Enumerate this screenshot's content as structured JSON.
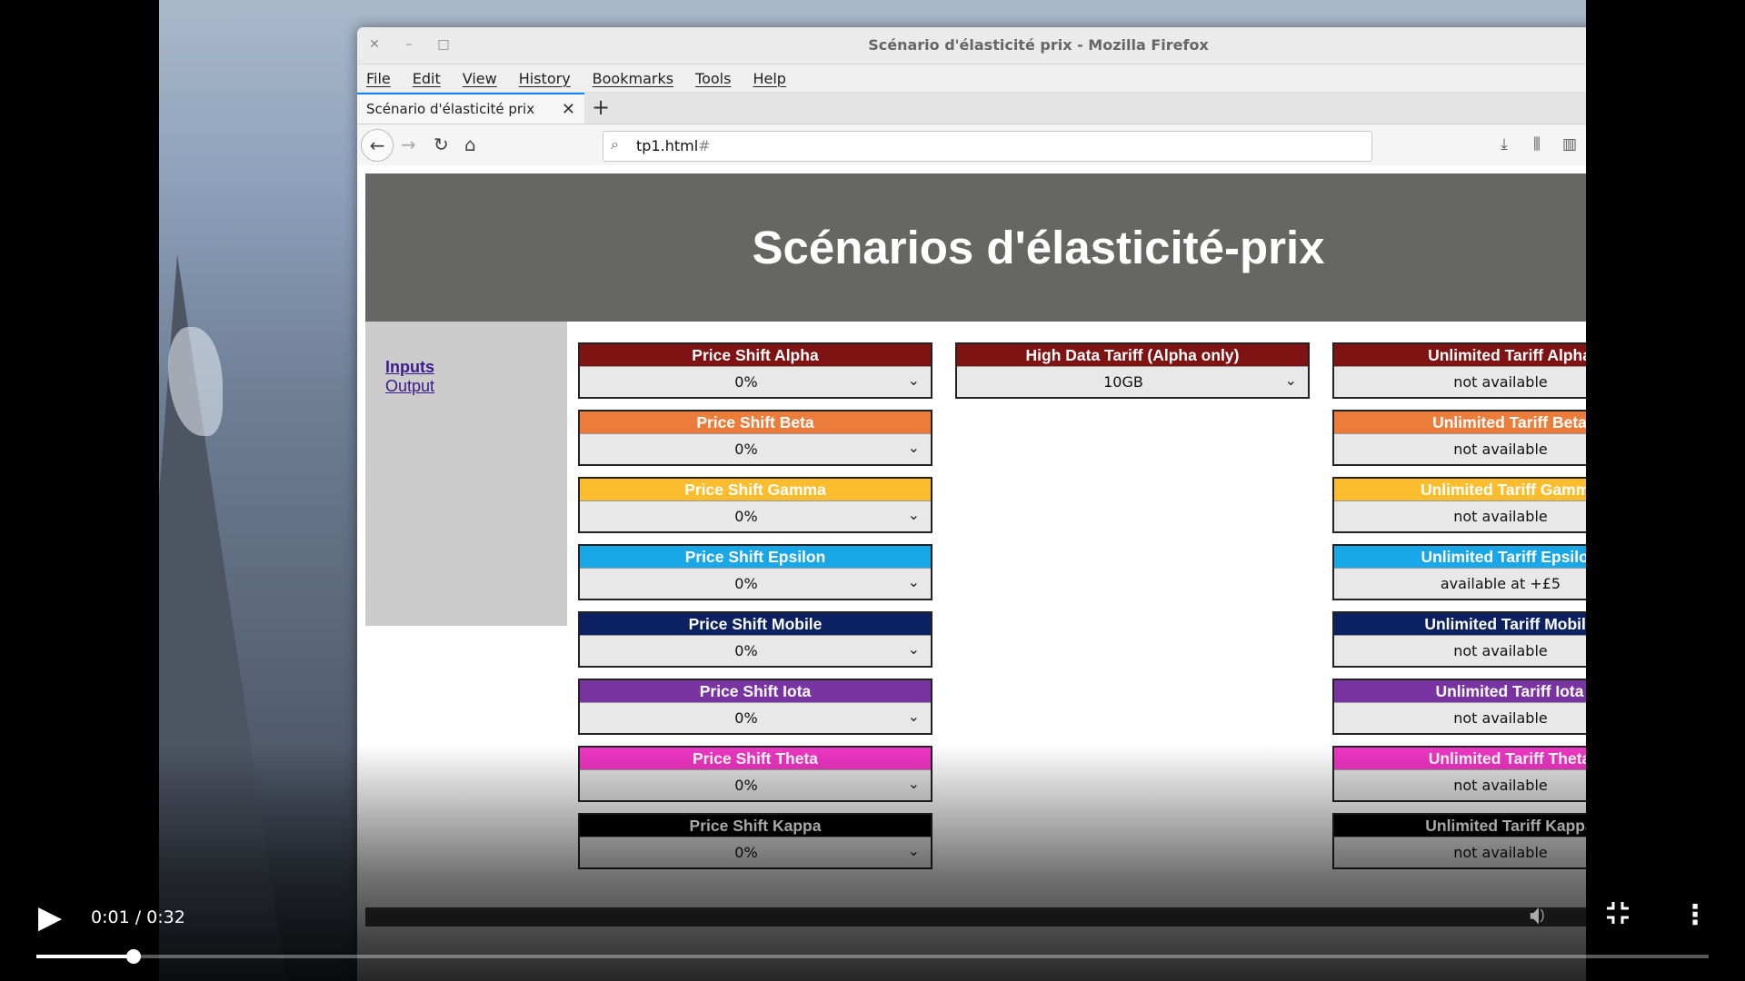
{
  "browser": {
    "window_title": "Scénario d'élasticité prix - Mozilla Firefox",
    "menu": [
      "File",
      "Edit",
      "View",
      "History",
      "Bookmarks",
      "Tools",
      "Help"
    ],
    "tab_title": "Scénario d'élasticité prix",
    "url_main": "tp1.html",
    "url_hash": "#"
  },
  "page": {
    "title": "Scénarios d'élasticité-prix",
    "nav": {
      "inputs": "Inputs",
      "output": "Output"
    },
    "price_shift": [
      {
        "label": "Price Shift Alpha",
        "value": "0%",
        "color": "#7f1212",
        "label_color": "#ffffff"
      },
      {
        "label": "Price Shift Beta",
        "value": "0%",
        "color": "#ec7c3a",
        "label_color": "#ffffff"
      },
      {
        "label": "Price Shift Gamma",
        "value": "0%",
        "color": "#fbbd2e",
        "label_color": "#ffffff"
      },
      {
        "label": "Price Shift Epsilon",
        "value": "0%",
        "color": "#1aa7e8",
        "label_color": "#ffffff"
      },
      {
        "label": "Price Shift Mobile",
        "value": "0%",
        "color": "#0b2160",
        "label_color": "#ffffff"
      },
      {
        "label": "Price Shift Iota",
        "value": "0%",
        "color": "#7a34a2",
        "label_color": "#ffffff"
      },
      {
        "label": "Price Shift Theta",
        "value": "0%",
        "color": "#ef36c4",
        "label_color": "#ffffff"
      },
      {
        "label": "Price Shift Kappa",
        "value": "0%",
        "color": "#000000",
        "label_color": "#ffffff"
      }
    ],
    "high_data": {
      "label": "High Data Tariff (Alpha only)",
      "value": "10GB",
      "color": "#7f1212",
      "label_color": "#ffffff"
    },
    "unlimited": [
      {
        "label": "Unlimited Tariff Alpha",
        "value": "not available",
        "color": "#7f1212",
        "label_color": "#ffffff"
      },
      {
        "label": "Unlimited Tariff Beta",
        "value": "not available",
        "color": "#ec7c3a",
        "label_color": "#ffffff"
      },
      {
        "label": "Unlimited Tariff Gamma",
        "value": "not available",
        "color": "#fbbd2e",
        "label_color": "#ffffff"
      },
      {
        "label": "Unlimited Tariff Epsilon",
        "value": "available at +£5",
        "color": "#1aa7e8",
        "label_color": "#ffffff"
      },
      {
        "label": "Unlimited Tariff Mobile",
        "value": "not available",
        "color": "#0b2160",
        "label_color": "#ffffff"
      },
      {
        "label": "Unlimited Tariff Iota",
        "value": "not available",
        "color": "#7a34a2",
        "label_color": "#ffffff"
      },
      {
        "label": "Unlimited Tariff Theta",
        "value": "not available",
        "color": "#ef36c4",
        "label_color": "#ffffff"
      },
      {
        "label": "Unlimited Tariff Kappa",
        "value": "not available",
        "color": "#000000",
        "label_color": "#ffffff"
      }
    ]
  },
  "player": {
    "time": "0:01 / 0:32",
    "progress_fraction": 0.058
  }
}
